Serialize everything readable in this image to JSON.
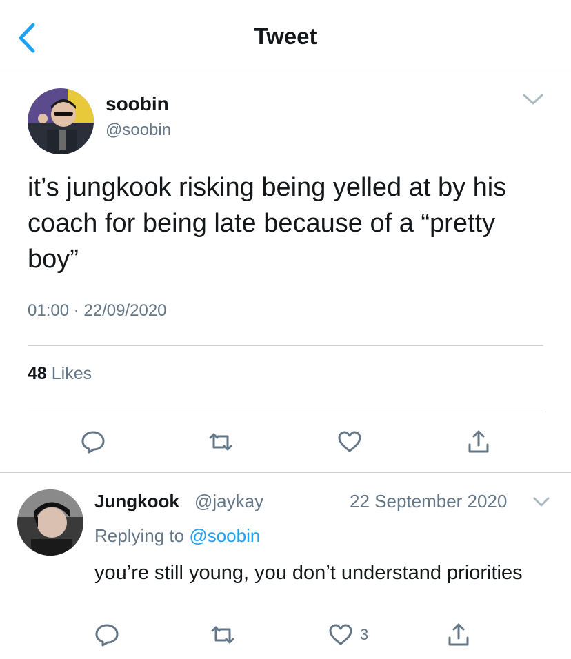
{
  "header": {
    "title": "Tweet"
  },
  "tweet": {
    "author_name": "soobin",
    "author_handle": "@soobin",
    "text": "it’s jungkook risking being yelled at by his coach for being late because of a “pretty boy”",
    "time": "01:00",
    "separator": "·",
    "date": "22/09/2020",
    "likes_count": "48",
    "likes_label": "Likes"
  },
  "reply": {
    "author_name": "Jungkook",
    "author_handle": "@jaykay",
    "date": "22 September 2020",
    "replying_prefix": "Replying to",
    "replying_to": "@soobin",
    "text": "you’re still young, you don’t understand priorities",
    "like_count": "3"
  },
  "colors": {
    "accent": "#1da1f2",
    "secondary_text": "#657786",
    "icon": "#657786",
    "divider": "#cfd4d8"
  },
  "icons": [
    "back-chevron-icon",
    "chevron-down-icon",
    "reply-icon",
    "retweet-icon",
    "like-icon",
    "share-icon"
  ]
}
